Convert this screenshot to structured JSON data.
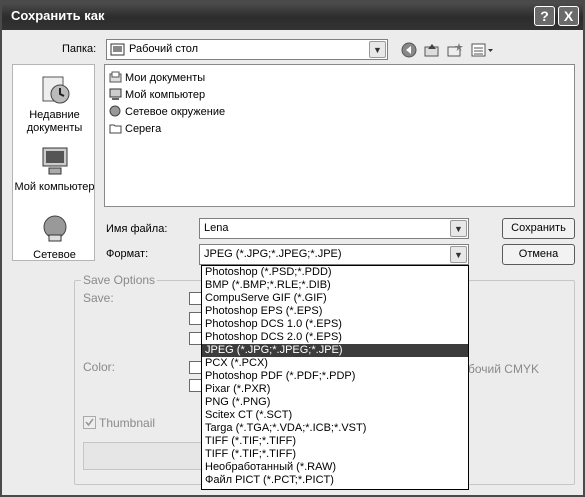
{
  "window": {
    "title": "Сохранить как",
    "help_label": "?",
    "close_label": "X"
  },
  "location": {
    "label": "Папка:",
    "value": "Рабочий стол"
  },
  "places": [
    {
      "label": "Недавние документы",
      "icon": "recent-documents-icon"
    },
    {
      "label": "Мой компьютер",
      "icon": "my-computer-icon"
    },
    {
      "label": "Сетевое",
      "icon": "network-icon"
    }
  ],
  "files": [
    {
      "name": "Мои документы",
      "icon": "my-documents-icon"
    },
    {
      "name": "Мой компьютер",
      "icon": "my-computer-icon"
    },
    {
      "name": "Сетевое окружение",
      "icon": "network-icon"
    },
    {
      "name": "Серега",
      "icon": "folder-icon"
    }
  ],
  "filename": {
    "label": "Имя файла:",
    "value": "Lena"
  },
  "format": {
    "label": "Формат:",
    "value": "JPEG (*.JPG;*.JPEG;*.JPE)",
    "options": [
      "Photoshop (*.PSD;*.PDD)",
      "BMP (*.BMP;*.RLE;*.DIB)",
      "CompuServe GIF (*.GIF)",
      "Photoshop EPS (*.EPS)",
      "Photoshop DCS 1.0 (*.EPS)",
      "Photoshop DCS 2.0 (*.EPS)",
      "JPEG (*.JPG;*.JPEG;*.JPE)",
      "PCX (*.PCX)",
      "Photoshop PDF (*.PDF;*.PDP)",
      "Pixar (*.PXR)",
      "PNG (*.PNG)",
      "Scitex CT (*.SCT)",
      "Targa (*.TGA;*.VDA;*.ICB;*.VST)",
      "TIFF (*.TIF;*.TIFF)",
      "TIFF (*.TIF;*.TIFF)",
      "Необработанный (*.RAW)",
      "Файл PICT (*.PCT;*.PICT)"
    ],
    "selected_index": 6
  },
  "buttons": {
    "save": "Сохранить",
    "cancel": "Отмена"
  },
  "save_options": {
    "group_label": "Save Options",
    "save_label": "Save:",
    "color_label": "Color:",
    "cmyk_fragment": "бочий CMYK",
    "thumbnail_label": "Thumbnail"
  },
  "colors": {
    "titlebar": "#333333",
    "selection": "#3c3c3c"
  }
}
